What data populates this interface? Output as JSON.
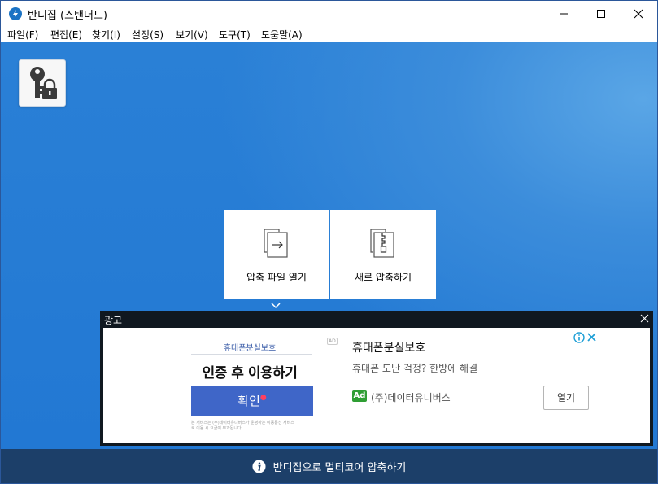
{
  "window": {
    "title": "반디집 (스탠더드)"
  },
  "menu": [
    {
      "label": "파일(F)"
    },
    {
      "label": "편집(E)"
    },
    {
      "label": "찾기(I)"
    },
    {
      "label": "설정(S)"
    },
    {
      "label": "보기(V)"
    },
    {
      "label": "도구(T)"
    },
    {
      "label": "도움말(A)"
    }
  ],
  "tiles": {
    "open_archive": {
      "label": "압축 파일 열기",
      "icon": "open-archive-icon"
    },
    "new_archive": {
      "label": "새로 압축하기",
      "icon": "new-archive-icon"
    }
  },
  "key_button": {
    "icon": "key-lock-icon"
  },
  "ad": {
    "panel_title": "광고",
    "image": {
      "title": "휴대폰분실보호",
      "headline": "인증 후 이용하기",
      "button_label": "확인",
      "fine_print": "본 서비스는 (주)데이터유니버스가 운영하는 이동통신 서비스로 이용 시 요금이 부과됩니다."
    },
    "mini_label": "AD",
    "headline": "휴대폰분실보호",
    "description": "휴대폰 도난 걱정? 한방에 해결",
    "badge": "Ad",
    "advertiser": "(주)데이터유니버스",
    "open_label": "열기"
  },
  "status": {
    "text": "반디집으로 멀티코어 압축하기"
  },
  "colors": {
    "background_blue": "#2278d3",
    "status_bar": "#1c3f69",
    "ad_frame": "#101820",
    "ad_badge": "#2f9e34",
    "ad_button": "#3f66c8"
  }
}
